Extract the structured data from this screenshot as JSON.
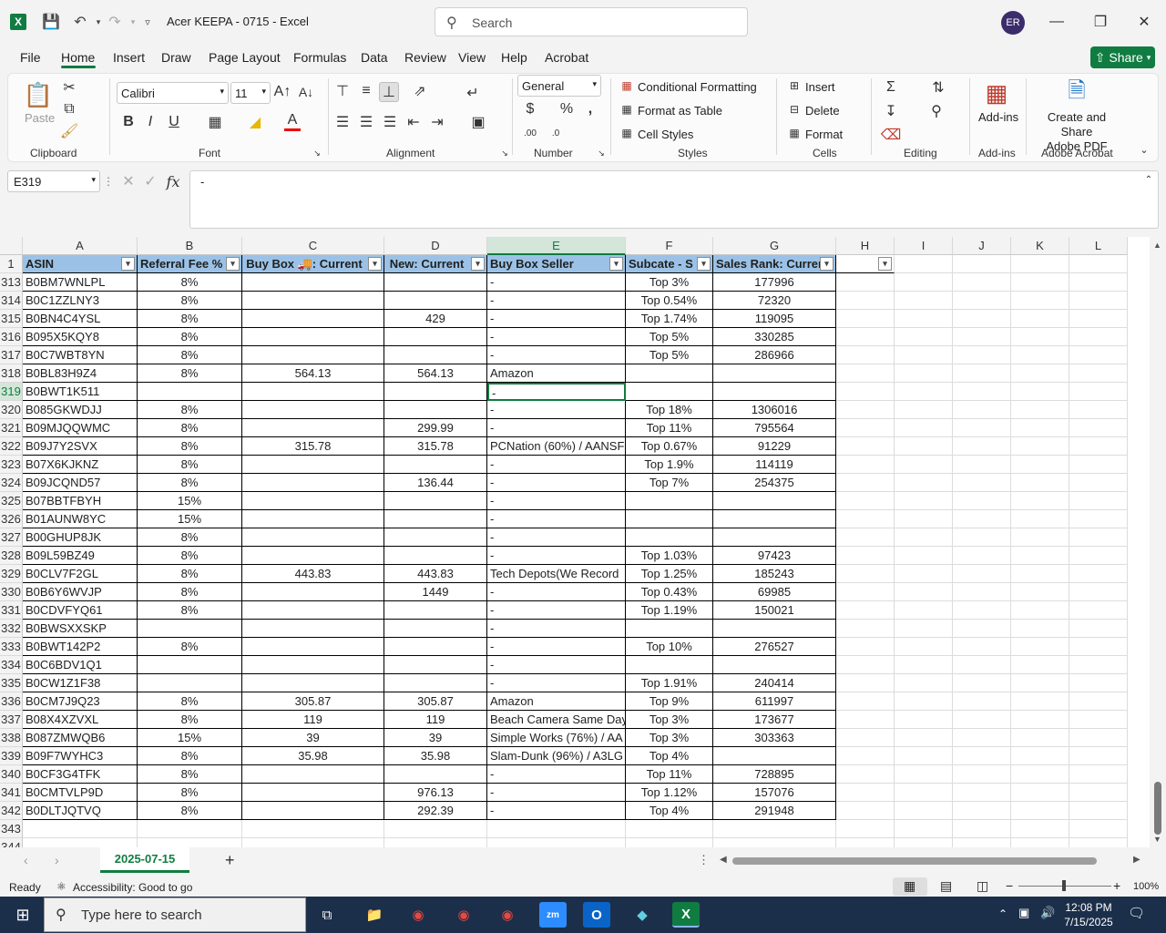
{
  "app": {
    "title": "Acer KEEPA - 0715  -  Excel",
    "search_placeholder": "Search",
    "avatar_initials": "ER",
    "share_label": "Share",
    "accent_color": "#107c41"
  },
  "menu": [
    "File",
    "Home",
    "Insert",
    "Draw",
    "Page Layout",
    "Formulas",
    "Data",
    "Review",
    "View",
    "Help",
    "Acrobat"
  ],
  "ribbon": {
    "paste": "Paste",
    "clipboard": "Clipboard",
    "font_name": "Calibri",
    "font_size": "11",
    "font": "Font",
    "alignment": "Alignment",
    "number_format": "General",
    "number": "Number",
    "conditional_formatting": "Conditional Formatting",
    "format_as_table": "Format as Table",
    "cell_styles": "Cell Styles",
    "styles": "Styles",
    "insert": "Insert",
    "delete": "Delete",
    "format": "Format",
    "cells": "Cells",
    "editing": "Editing",
    "addins_btn": "Add-ins",
    "addins": "Add-ins",
    "acrobat_btn": "Create and Share Adobe PDF",
    "acrobat_btn_l1": "Create and Share",
    "acrobat_btn_l2": "Adobe PDF",
    "acrobat_group": "Adobe Acrobat"
  },
  "formula_bar": {
    "name_box": "E319",
    "formula": "-"
  },
  "columns": [
    "A",
    "B",
    "C",
    "D",
    "E",
    "F",
    "G",
    "H",
    "I",
    "J",
    "K",
    "L"
  ],
  "table_headers": [
    "ASIN",
    "Referral Fee %",
    "Buy Box 🚚: Current",
    "New: Current",
    "Buy Box Seller",
    "Subcate - S",
    "Sales Rank: Current",
    ""
  ],
  "header_row_number": "1",
  "rows": [
    {
      "n": "313",
      "a": "B0BM7WNLPL",
      "b": "8%",
      "c": "",
      "d": "",
      "e": "-",
      "f": "Top 3%",
      "g": "177996"
    },
    {
      "n": "314",
      "a": "B0C1ZZLNY3",
      "b": "8%",
      "c": "",
      "d": "",
      "e": "-",
      "f": "Top 0.54%",
      "g": "72320"
    },
    {
      "n": "315",
      "a": "B0BN4C4YSL",
      "b": "8%",
      "c": "",
      "d": "429",
      "e": "-",
      "f": "Top 1.74%",
      "g": "119095"
    },
    {
      "n": "316",
      "a": "B095X5KQY8",
      "b": "8%",
      "c": "",
      "d": "",
      "e": "-",
      "f": "Top 5%",
      "g": "330285"
    },
    {
      "n": "317",
      "a": "B0C7WBT8YN",
      "b": "8%",
      "c": "",
      "d": "",
      "e": "-",
      "f": "Top 5%",
      "g": "286966"
    },
    {
      "n": "318",
      "a": "B0BL83H9Z4",
      "b": "8%",
      "c": "564.13",
      "d": "564.13",
      "e": "Amazon",
      "f": "",
      "g": ""
    },
    {
      "n": "319",
      "a": "B0BWT1K511",
      "b": "",
      "c": "",
      "d": "",
      "e": "-",
      "f": "",
      "g": ""
    },
    {
      "n": "320",
      "a": "B085GKWDJJ",
      "b": "8%",
      "c": "",
      "d": "",
      "e": "-",
      "f": "Top 18%",
      "g": "1306016"
    },
    {
      "n": "321",
      "a": "B09MJQQWMC",
      "b": "8%",
      "c": "",
      "d": "299.99",
      "e": "-",
      "f": "Top 11%",
      "g": "795564"
    },
    {
      "n": "322",
      "a": "B09J7Y2SVX",
      "b": "8%",
      "c": "315.78",
      "d": "315.78",
      "e": "PCNation (60%) / AANSF",
      "f": "Top 0.67%",
      "g": "91229"
    },
    {
      "n": "323",
      "a": "B07X6KJKNZ",
      "b": "8%",
      "c": "",
      "d": "",
      "e": "-",
      "f": "Top 1.9%",
      "g": "114119"
    },
    {
      "n": "324",
      "a": "B09JCQND57",
      "b": "8%",
      "c": "",
      "d": "136.44",
      "e": "-",
      "f": "Top 7%",
      "g": "254375"
    },
    {
      "n": "325",
      "a": "B07BBTFBYH",
      "b": "15%",
      "c": "",
      "d": "",
      "e": "-",
      "f": "",
      "g": ""
    },
    {
      "n": "326",
      "a": "B01AUNW8YC",
      "b": "15%",
      "c": "",
      "d": "",
      "e": "-",
      "f": "",
      "g": ""
    },
    {
      "n": "327",
      "a": "B00GHUP8JK",
      "b": "8%",
      "c": "",
      "d": "",
      "e": "-",
      "f": "",
      "g": ""
    },
    {
      "n": "328",
      "a": "B09L59BZ49",
      "b": "8%",
      "c": "",
      "d": "",
      "e": "-",
      "f": "Top 1.03%",
      "g": "97423"
    },
    {
      "n": "329",
      "a": "B0CLV7F2GL",
      "b": "8%",
      "c": "443.83",
      "d": "443.83",
      "e": "Tech Depots(We Record",
      "f": "Top 1.25%",
      "g": "185243"
    },
    {
      "n": "330",
      "a": "B0B6Y6WVJP",
      "b": "8%",
      "c": "",
      "d": "1449",
      "e": "-",
      "f": "Top 0.43%",
      "g": "69985"
    },
    {
      "n": "331",
      "a": "B0CDVFYQ61",
      "b": "8%",
      "c": "",
      "d": "",
      "e": "-",
      "f": "Top 1.19%",
      "g": "150021"
    },
    {
      "n": "332",
      "a": "B0BWSXXSKP",
      "b": "",
      "c": "",
      "d": "",
      "e": "-",
      "f": "",
      "g": ""
    },
    {
      "n": "333",
      "a": "B0BWT142P2",
      "b": "8%",
      "c": "",
      "d": "",
      "e": "-",
      "f": "Top 10%",
      "g": "276527"
    },
    {
      "n": "334",
      "a": "B0C6BDV1Q1",
      "b": "",
      "c": "",
      "d": "",
      "e": "-",
      "f": "",
      "g": ""
    },
    {
      "n": "335",
      "a": "B0CW1Z1F38",
      "b": "",
      "c": "",
      "d": "",
      "e": "-",
      "f": "Top 1.91%",
      "g": "240414"
    },
    {
      "n": "336",
      "a": "B0CM7J9Q23",
      "b": "8%",
      "c": "305.87",
      "d": "305.87",
      "e": "Amazon",
      "f": "Top 9%",
      "g": "611997"
    },
    {
      "n": "337",
      "a": "B08X4XZVXL",
      "b": "8%",
      "c": "119",
      "d": "119",
      "e": "Beach Camera Same Day",
      "f": "Top 3%",
      "g": "173677"
    },
    {
      "n": "338",
      "a": "B087ZMWQB6",
      "b": "15%",
      "c": "39",
      "d": "39",
      "e": "Simple Works (76%) / AA",
      "f": "Top 3%",
      "g": "303363"
    },
    {
      "n": "339",
      "a": "B09F7WYHC3",
      "b": "8%",
      "c": "35.98",
      "d": "35.98",
      "e": "Slam-Dunk (96%) / A3LG",
      "f": "Top 4%",
      "g": ""
    },
    {
      "n": "340",
      "a": "B0CF3G4TFK",
      "b": "8%",
      "c": "",
      "d": "",
      "e": "-",
      "f": "Top 11%",
      "g": "728895"
    },
    {
      "n": "341",
      "a": "B0CMTVLP9D",
      "b": "8%",
      "c": "",
      "d": "976.13",
      "e": "-",
      "f": "Top 1.12%",
      "g": "157076"
    },
    {
      "n": "342",
      "a": "B0DLTJQTVQ",
      "b": "8%",
      "c": "",
      "d": "292.39",
      "e": "-",
      "f": "Top 4%",
      "g": "291948"
    }
  ],
  "extra_rows": [
    "343",
    "344"
  ],
  "sheet": {
    "tab": "2025-07-15"
  },
  "status": {
    "ready": "Ready",
    "accessibility": "Accessibility: Good to go",
    "zoom": "100%"
  },
  "taskbar": {
    "search_placeholder": "Type here to search",
    "time": "12:08 PM",
    "date": "7/15/2025"
  }
}
